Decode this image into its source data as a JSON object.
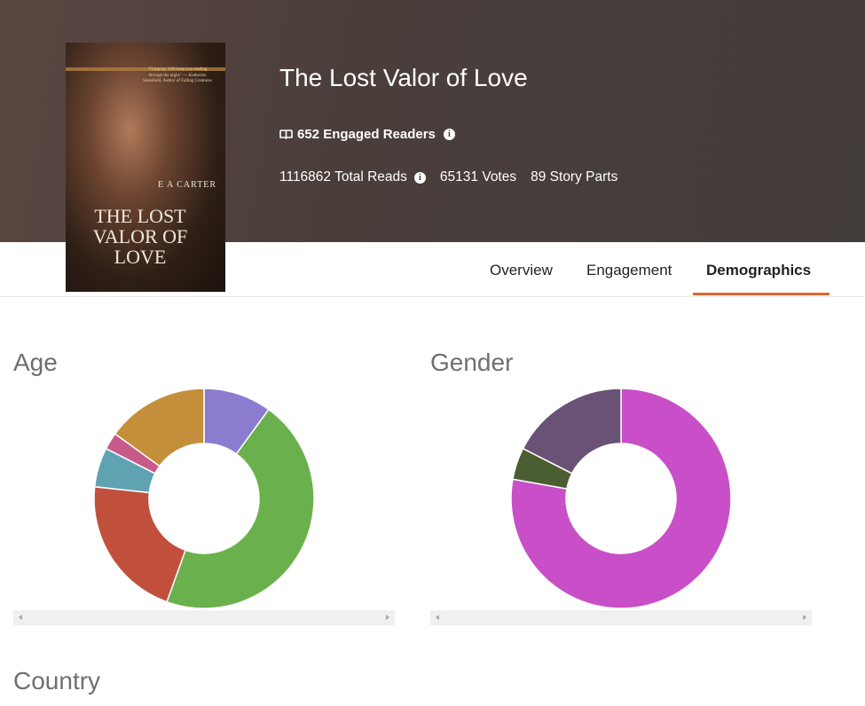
{
  "book": {
    "title": "The Lost Valor of Love",
    "engaged_readers": "652 Engaged Readers",
    "total_reads": "1116862 Total Reads",
    "votes": "65131 Votes",
    "story_parts": "89 Story Parts",
    "cover": {
      "quote": "\"Gripping. Will keep you reading through the night.\" — Katherine Stansfield, Author of Falling Creatures",
      "author": "E A CARTER",
      "title": "THE LOST VALOR OF LOVE"
    }
  },
  "tabs": [
    {
      "label": "Overview"
    },
    {
      "label": "Engagement"
    },
    {
      "label": "Demographics",
      "active": true
    }
  ],
  "accent": "#e8622c",
  "sections": {
    "age": "Age",
    "gender": "Gender",
    "country": "Country"
  },
  "chart_data": [
    {
      "type": "pie",
      "donut": true,
      "title": "Age",
      "values": [
        10,
        45.5,
        21.2,
        5.8,
        2.5,
        15
      ],
      "colors": [
        "#8b7ccf",
        "#6ab04c",
        "#c0503c",
        "#5fa3b3",
        "#c85a8a",
        "#c48f3a"
      ]
    },
    {
      "type": "pie",
      "donut": true,
      "title": "Gender",
      "values": [
        77.8,
        4.7,
        17.5
      ],
      "colors": [
        "#c84fc8",
        "#4a5e32",
        "#6a5276"
      ]
    }
  ]
}
